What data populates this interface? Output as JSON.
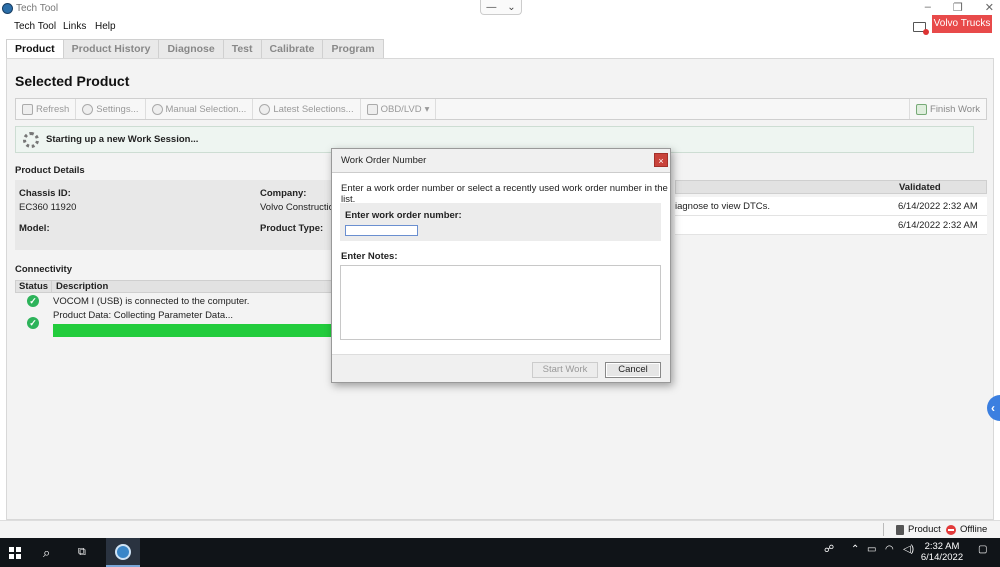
{
  "window": {
    "title": "Tech Tool"
  },
  "menu": [
    {
      "label": "Tech Tool"
    },
    {
      "label": "Links"
    },
    {
      "label": "Help"
    }
  ],
  "brand": {
    "label": "Volvo Trucks",
    "color": "#e84a4a"
  },
  "tabs": [
    {
      "label": "Product",
      "active": true
    },
    {
      "label": "Product History"
    },
    {
      "label": "Diagnose"
    },
    {
      "label": "Test"
    },
    {
      "label": "Calibrate"
    },
    {
      "label": "Program"
    }
  ],
  "page": {
    "title": "Selected Product"
  },
  "toolbar": {
    "refresh": "Refresh",
    "settings": "Settings...",
    "manual_selection": "Manual Selection...",
    "latest_selections": "Latest Selections...",
    "obd": "OBD/LVD",
    "finish_work": "Finish Work"
  },
  "session": {
    "message": "Starting up a new Work Session..."
  },
  "product_details": {
    "heading": "Product Details",
    "chassis_label": "Chassis ID:",
    "chassis_value": "EC360 11920",
    "company_label": "Company:",
    "company_value": "Volvo Construction",
    "model_label": "Model:",
    "model_value": "",
    "product_type_label": "Product Type:",
    "product_type_value": ""
  },
  "connectivity": {
    "heading": "Connectivity",
    "col_status": "Status",
    "col_description": "Description",
    "rows": [
      {
        "description": "VOCOM I (USB) is connected to the computer.",
        "status": "ok"
      },
      {
        "description": "Product Data: Collecting Parameter Data...",
        "status": "ok",
        "progress": 0.99
      }
    ]
  },
  "dtc": {
    "col_validated": "Validated",
    "rows": [
      {
        "text": "iagnose to view DTCs.",
        "date": "6/14/2022 2:32 AM"
      },
      {
        "text": "",
        "date": "6/14/2022 2:32 AM"
      }
    ]
  },
  "dialog": {
    "title": "Work Order Number",
    "close": "×",
    "instruction": "Enter a work order number or select a recently used work order number in the list.",
    "work_order_label": "Enter work order number:",
    "work_order_value": "",
    "notes_label": "Enter Notes:",
    "notes_value": "",
    "start_button": "Start Work",
    "cancel_button": "Cancel"
  },
  "statusbar": {
    "product": "Product",
    "offline": "Offline"
  },
  "taskbar": {
    "time": "2:32 AM",
    "date": "6/14/2022"
  },
  "colors": {
    "accent_green": "#22cc3c",
    "close_red": "#c9433b",
    "offline_red": "#e23a3a"
  }
}
